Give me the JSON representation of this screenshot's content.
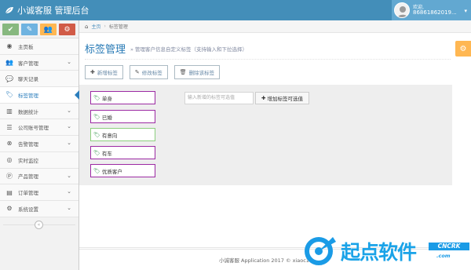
{
  "app": {
    "title": "小诚客服 管理后台"
  },
  "user": {
    "welcome": "欢迎,",
    "id": "86861862019..."
  },
  "shortcuts": [
    {
      "icon": "signal-icon",
      "glyph": "✔"
    },
    {
      "icon": "pencil-icon",
      "glyph": "✎"
    },
    {
      "icon": "users-icon",
      "glyph": "👥"
    },
    {
      "icon": "cogs-icon",
      "glyph": "⚙"
    }
  ],
  "sidebar": {
    "items": [
      {
        "label": "主页板",
        "icon": "dashboard-icon",
        "glyph": "◉",
        "has_submenu": false,
        "active": false
      },
      {
        "label": "客户管理",
        "icon": "users-icon",
        "glyph": "👥",
        "has_submenu": true,
        "active": false
      },
      {
        "label": "聊天记录",
        "icon": "comments-icon",
        "glyph": "💬",
        "has_submenu": false,
        "active": false
      },
      {
        "label": "标签管理",
        "icon": "tags-icon",
        "glyph": "🏷",
        "has_submenu": false,
        "active": true
      },
      {
        "label": "数据统计",
        "icon": "bar-chart-icon",
        "glyph": "▥",
        "has_submenu": true,
        "active": false
      },
      {
        "label": "公司账号管理",
        "icon": "list-icon",
        "glyph": "☰",
        "has_submenu": true,
        "active": false
      },
      {
        "label": "告警管理",
        "icon": "alert-icon",
        "glyph": "⊗",
        "has_submenu": true,
        "active": false
      },
      {
        "label": "实时监控",
        "icon": "eye-icon",
        "glyph": "◎",
        "has_submenu": false,
        "active": false
      },
      {
        "label": "产品管理",
        "icon": "product-icon",
        "glyph": "Ⓟ",
        "has_submenu": true,
        "active": false
      },
      {
        "label": "订单管理",
        "icon": "order-icon",
        "glyph": "▤",
        "has_submenu": true,
        "active": false
      },
      {
        "label": "系统设置",
        "icon": "gear-icon",
        "glyph": "⚙",
        "has_submenu": true,
        "active": false
      }
    ]
  },
  "breadcrumbs": {
    "home": "主页",
    "current": "标签管理"
  },
  "page": {
    "title": "标签管理",
    "subtitle": "» 管理客户信息自定义标签（支持输入和下拉选择）"
  },
  "toolbar": {
    "add": "新增标签",
    "edit": "修改标签",
    "delete": "删除该标签"
  },
  "tags": [
    {
      "label": "单身",
      "selected": false
    },
    {
      "label": "已婚",
      "selected": false
    },
    {
      "label": "有意向",
      "selected": true
    },
    {
      "label": "有车",
      "selected": false
    },
    {
      "label": "优质客户",
      "selected": false
    }
  ],
  "tag_input": {
    "placeholder": "输入新增的标签可选值"
  },
  "add_tag_button": "增加标签可选值",
  "footer": {
    "text": "小诚客服 Application 2017 © xiaoc10"
  },
  "watermark": {
    "brand": "起点软件",
    "sub": "CNCRK",
    "url": ".com"
  },
  "colors": {
    "navbar": "#438eb9",
    "accent": "#2679b5",
    "tag_border": "#9c2aa3",
    "tag_selected_border": "#8ccf7e"
  }
}
